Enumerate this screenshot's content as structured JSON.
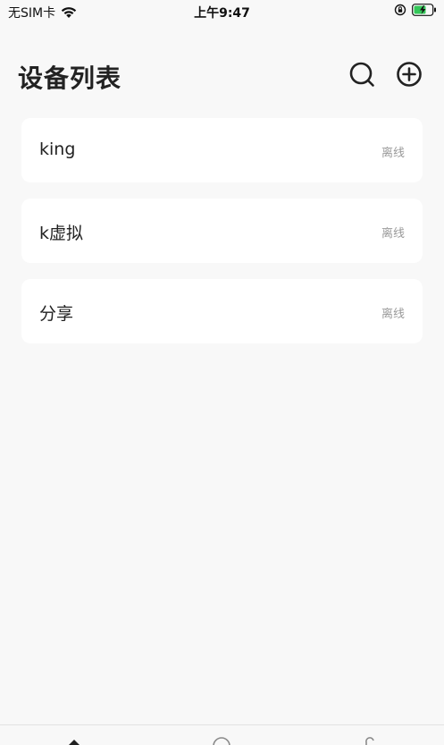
{
  "status_bar": {
    "carrier": "无SIM卡",
    "time": "上午9:47",
    "wifi_icon": "wifi-icon",
    "lock_icon": "orientation-lock-icon",
    "battery_icon": "battery-charging-icon",
    "battery_color": "#34c759"
  },
  "header": {
    "title": "设备列表",
    "search_icon": "search-icon",
    "add_icon": "add-circle-icon"
  },
  "devices": [
    {
      "name": "king",
      "status": "离线"
    },
    {
      "name": "k虚拟",
      "status": "离线"
    },
    {
      "name": "分享",
      "status": "离线"
    }
  ],
  "tab_bar": {
    "tabs": [
      {
        "icon": "home-icon"
      },
      {
        "icon": "circle-icon"
      },
      {
        "icon": "profile-icon"
      }
    ]
  }
}
